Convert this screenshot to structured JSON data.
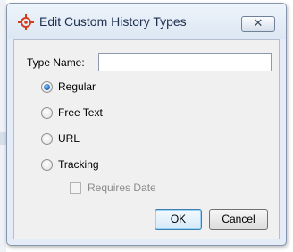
{
  "dialog": {
    "title": "Edit Custom History Types",
    "close_glyph": "✕",
    "icon": "target-crosshair-icon"
  },
  "form": {
    "type_name_label": "Type Name:",
    "type_name_value": "",
    "type_name_placeholder": ""
  },
  "options": [
    {
      "label": "Regular",
      "checked": true
    },
    {
      "label": "Free Text",
      "checked": false
    },
    {
      "label": "URL",
      "checked": false
    },
    {
      "label": "Tracking",
      "checked": false
    }
  ],
  "requires_date": {
    "label": "Requires Date",
    "checked": false,
    "enabled": false
  },
  "buttons": {
    "ok": "OK",
    "cancel": "Cancel"
  },
  "colors": {
    "accent": "#d43c1c",
    "focus": "#3c7fb1",
    "window_frame": "#e4edf7"
  }
}
